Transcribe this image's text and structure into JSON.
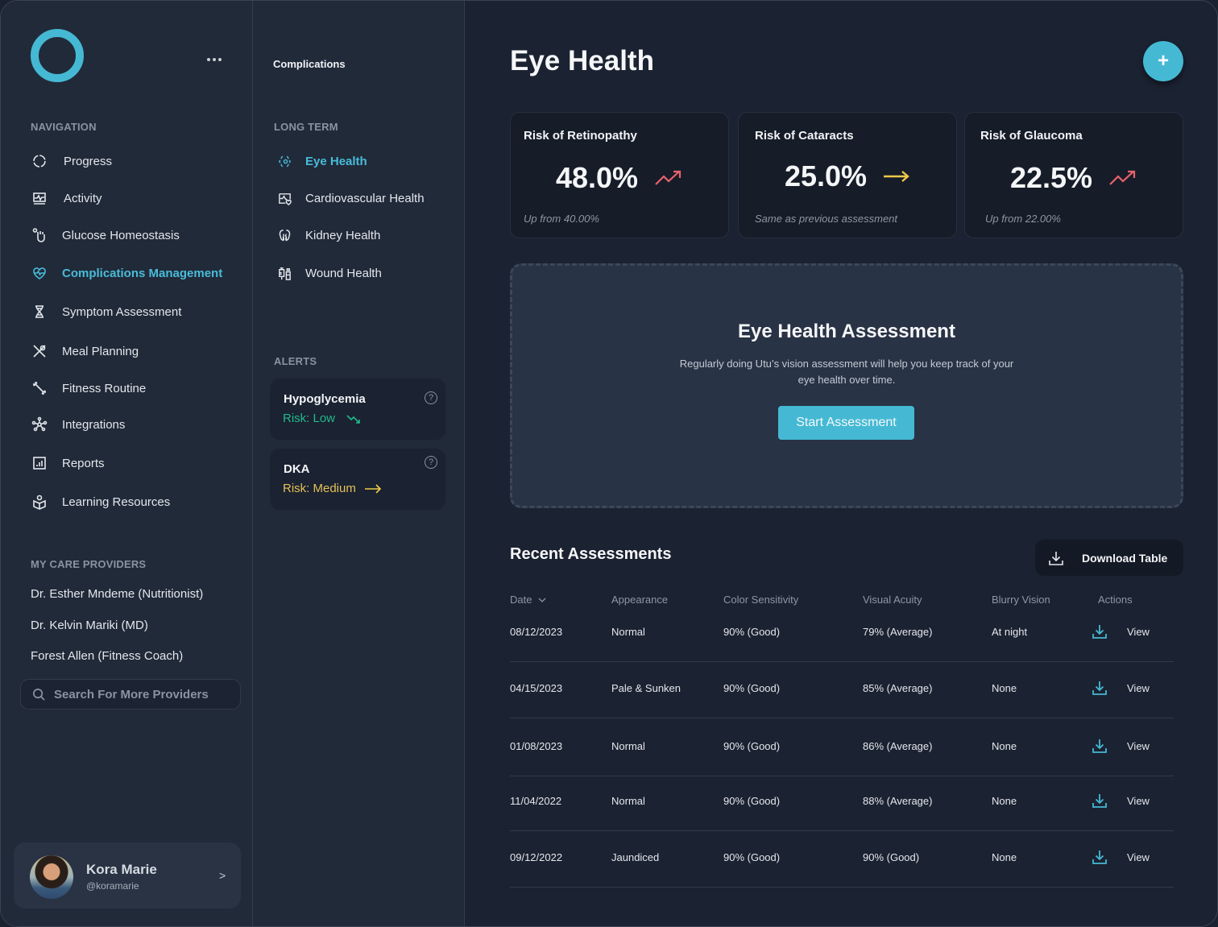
{
  "colors": {
    "accent": "#45b9d4",
    "risk_up": "#e8636b",
    "risk_same": "#f0c94a",
    "risk_low": "#22b98c"
  },
  "nav": {
    "logo": "utu-ring-logo",
    "more_icon": "more-horizontal-icon",
    "section_label": "NAVIGATION",
    "items": [
      {
        "label": "Progress",
        "icon": "progress-ring-icon",
        "active": false
      },
      {
        "label": "Activity",
        "icon": "activity-monitor-icon",
        "active": false
      },
      {
        "label": "Glucose Homeostasis",
        "icon": "glucose-hand-icon",
        "active": false
      },
      {
        "label": "Complications Management",
        "icon": "heart-pulse-icon",
        "active": true
      },
      {
        "label": "Symptom Assessment",
        "icon": "dna-icon",
        "active": false
      },
      {
        "label": "Meal Planning",
        "icon": "utensils-icon",
        "active": false
      },
      {
        "label": "Fitness Routine",
        "icon": "dumbbell-icon",
        "active": false
      },
      {
        "label": "Integrations",
        "icon": "network-icon",
        "active": false
      },
      {
        "label": "Reports",
        "icon": "report-chart-icon",
        "active": false
      },
      {
        "label": "Learning Resources",
        "icon": "reader-book-icon",
        "active": false
      }
    ],
    "providers_label": "MY CARE PROVIDERS",
    "providers": [
      "Dr. Esther Mndeme (Nutritionist)",
      "Dr. Kelvin Mariki  (MD)",
      "Forest Allen (Fitness Coach)"
    ],
    "search_placeholder": "Search For More Providers",
    "profile": {
      "name": "Kora Marie",
      "handle": "@koramarie",
      "chevron": ">"
    }
  },
  "subnav": {
    "title": "Complications",
    "long_term_label": "LONG TERM",
    "items": [
      {
        "label": "Eye Health",
        "icon": "eye-icon",
        "active": true
      },
      {
        "label": "Cardiovascular Health",
        "icon": "heart-monitor-icon",
        "active": false
      },
      {
        "label": "Kidney Health",
        "icon": "kidney-icon",
        "active": false
      },
      {
        "label": "Wound Health",
        "icon": "syringe-bottle-icon",
        "active": false
      }
    ],
    "alerts_label": "ALERTS",
    "alerts": [
      {
        "title": "Hypoglycemia",
        "risk": "Risk: Low",
        "trend": "down",
        "help": "?"
      },
      {
        "title": "DKA",
        "risk": "Risk: Medium",
        "trend": "flat",
        "help": "?"
      }
    ]
  },
  "main": {
    "title": "Eye Health",
    "add_label": "+",
    "stats": [
      {
        "label": "Risk of Retinopathy",
        "value": "48.0%",
        "trend": "up",
        "note": "Up from 40.00%"
      },
      {
        "label": "Risk of Cataracts",
        "value": "25.0%",
        "trend": "flat",
        "note": "Same as previous assessment"
      },
      {
        "label": "Risk of Glaucoma",
        "value": "22.5%",
        "trend": "up",
        "note": "Up from 22.00%"
      }
    ],
    "assessment": {
      "title": "Eye Health Assessment",
      "description": "Regularly doing Utu’s vision assessment will help you keep track of your eye health over time.",
      "button": "Start Assessment"
    },
    "recent": {
      "title": "Recent Assessments",
      "download_label": "Download Table",
      "columns": [
        "Date",
        "Appearance",
        "Color Sensitivity",
        "Visual Acuity",
        "Blurry Vision",
        "Actions"
      ],
      "sort_column": "Date",
      "rows": [
        {
          "date": "08/12/2023",
          "appearance": "Normal",
          "color": "90% (Good)",
          "acuity": "79% (Average)",
          "blurry": "At night",
          "action": "View"
        },
        {
          "date": "04/15/2023",
          "appearance": "Pale & Sunken",
          "color": "90% (Good)",
          "acuity": "85% (Average)",
          "blurry": "None",
          "action": "View"
        },
        {
          "date": "01/08/2023",
          "appearance": "Normal",
          "color": "90% (Good)",
          "acuity": "86% (Average)",
          "blurry": "None",
          "action": "View"
        },
        {
          "date": "11/04/2022",
          "appearance": "Normal",
          "color": "90% (Good)",
          "acuity": "88% (Average)",
          "blurry": "None",
          "action": "View"
        },
        {
          "date": "09/12/2022",
          "appearance": "Jaundiced",
          "color": "90% (Good)",
          "acuity": "90% (Good)",
          "blurry": "None",
          "action": "View"
        }
      ]
    }
  }
}
